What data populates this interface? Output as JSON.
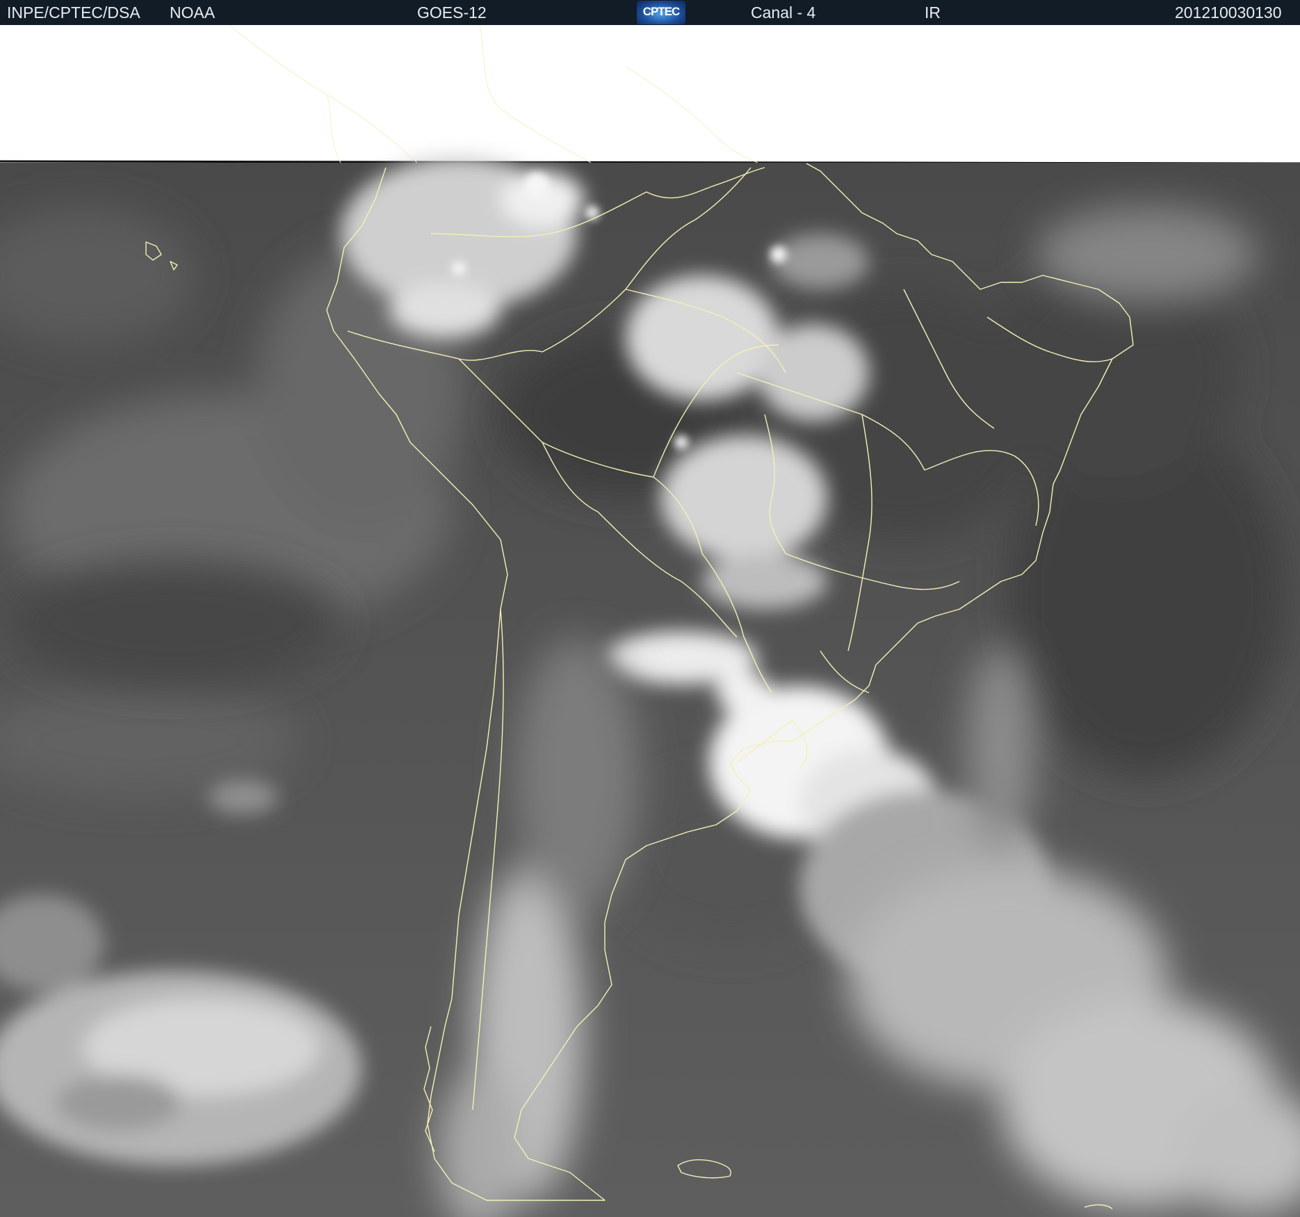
{
  "header": {
    "agency": "INPE/CPTEC/DSA",
    "source": "NOAA",
    "satellite": "GOES-12",
    "logo_text": "CPTEC",
    "channel": "Canal - 4",
    "band": "IR",
    "timestamp": "201210030130"
  },
  "colors": {
    "header_bg": "#111c27",
    "header_text": "#e8ecef",
    "border_lines": "#f4f0b8",
    "ocean_gray": "#5b5b5b",
    "cloud_white": "#f2f2f2"
  },
  "icons": {
    "logo": "cptec-logo"
  }
}
